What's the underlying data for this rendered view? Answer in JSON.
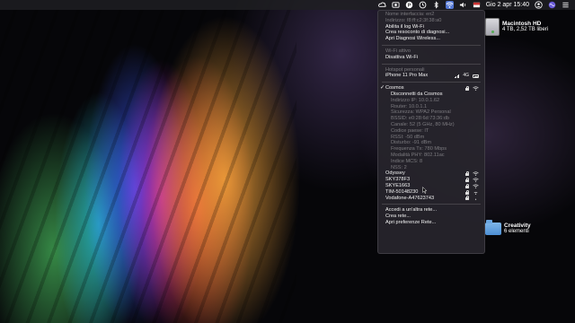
{
  "menubar": {
    "clock": "Gio 2 apr  15:40"
  },
  "desktop": {
    "drive": {
      "name": "Macintosh HD",
      "info": "4 TB, 2,52 TB liberi"
    },
    "folder": {
      "name": "Creativity",
      "info": "6 elementi"
    }
  },
  "wifi_menu": {
    "interface_name": "Nome interfaccia: en2",
    "address": "Indirizzo: f8:ff:c2:3f:38:a0",
    "enable_logs": "Abilita il log Wi-Fi",
    "create_report": "Crea resoconto di diagnosi...",
    "open_diagnostics": "Apri Diagnosi Wireless...",
    "wifi_active": "Wi-Fi attivo",
    "disable_wifi": "Disattiva Wi-Fi",
    "hotspot_header": "Hotspot personali",
    "hotspot_name": "iPhone 11 Pro Max",
    "hotspot_tech": "4G",
    "current_network": "Cosmos",
    "disconnect": "Disconnetti da Cosmos",
    "details": [
      "Indirizzo IP: 10.0.1.62",
      "Router: 10.0.1.1",
      "Sicurezza: WPA2 Personal",
      "BSSID: e0:28:6d:73:36:db",
      "Canale: 52 (5 GHz, 80 MHz)",
      "Codice paese: IT",
      "RSSI: -50 dBm",
      "Disturbo: -91 dBm",
      "Frequenza Tx: 780 Mbps",
      "Modalità PHY: 802.11ac",
      "Indice MCS: 8",
      "NSS: 2"
    ],
    "networks": [
      "Odyssey",
      "SKY378F3",
      "SKYE1663",
      "TIM-50148230",
      "Vodafone-A47623743"
    ],
    "join_other": "Accedi a un'altra rete...",
    "create_network": "Crea rete...",
    "open_prefs": "Apri preferenze Rete..."
  }
}
